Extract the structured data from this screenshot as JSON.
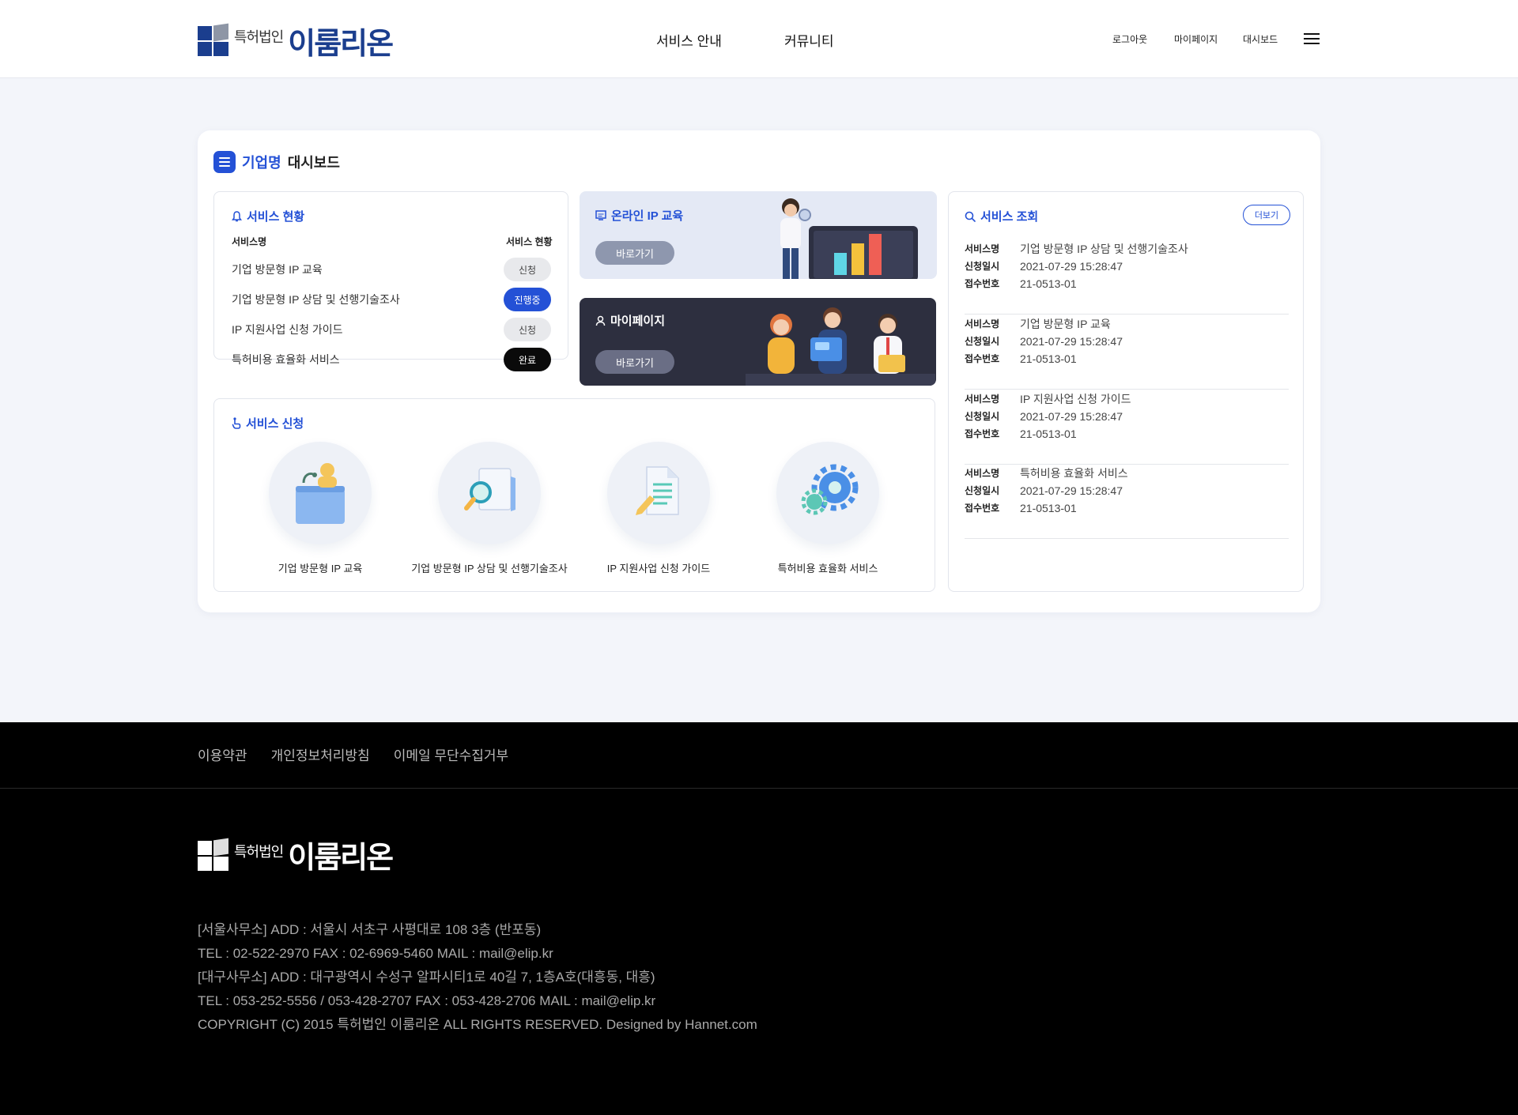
{
  "header": {
    "logo_small": "특허법인",
    "logo_big": "이룸리온",
    "nav": [
      "서비스 안내",
      "커뮤니티"
    ],
    "util": [
      "로그아웃",
      "마이페이지",
      "대시보드"
    ]
  },
  "dashboard": {
    "title_accent": "기업명",
    "title_rest": "대시보드"
  },
  "status_card": {
    "title": "서비스 현황",
    "col_name": "서비스명",
    "col_status": "서비스 현황",
    "rows": [
      {
        "name": "기업 방문형 IP 교육",
        "status": "신청"
      },
      {
        "name": "기업 방문형 IP 상담 및 선행기술조사",
        "status": "진행중"
      },
      {
        "name": "IP 지원사업 신청 가이드",
        "status": "신청"
      },
      {
        "name": "특허비용 효율화 서비스",
        "status": "완료"
      }
    ]
  },
  "online_banner": {
    "title": "온라인 IP 교육",
    "button": "바로가기"
  },
  "mypage_banner": {
    "title": "마이페이지",
    "button": "바로가기"
  },
  "apply_card": {
    "title": "서비스 신청",
    "items": [
      "기업 방문형 IP 교육",
      "기업 방문형 IP 상담 및 선행기술조사",
      "IP 지원사업 신청 가이드",
      "특허비용 효율화 서비스"
    ]
  },
  "query_card": {
    "title": "서비스 조회",
    "more": "더보기",
    "label_name": "서비스명",
    "label_date": "신청일시",
    "label_no": "접수번호",
    "items": [
      {
        "name": "기업 방문형 IP 상담 및 선행기술조사",
        "date": "2021-07-29 15:28:47",
        "no": "21-0513-01"
      },
      {
        "name": "기업 방문형 IP 교육",
        "date": "2021-07-29 15:28:47",
        "no": "21-0513-01"
      },
      {
        "name": "IP 지원사업 신청 가이드",
        "date": "2021-07-29 15:28:47",
        "no": "21-0513-01"
      },
      {
        "name": "특허비용 효율화 서비스",
        "date": "2021-07-29 15:28:47",
        "no": "21-0513-01"
      }
    ]
  },
  "footer": {
    "links": [
      "이용약관",
      "개인정보처리방침",
      "이메일 무단수집거부"
    ],
    "logo_small": "특허법인",
    "logo_big": "이룸리온",
    "address": [
      "[서울사무소] ADD : 서울시 서초구 사평대로 108 3층 (반포동)",
      "TEL : 02-522-2970 FAX : 02-6969-5460 MAIL : mail@elip.kr",
      "[대구사무소] ADD : 대구광역시 수성구 알파시티1로 40길 7, 1층A호(대흥동, 대흥)",
      "TEL : 053-252-5556 / 053-428-2707 FAX : 053-428-2706 MAIL : mail@elip.kr",
      "COPYRIGHT (C) 2015 특허법인 이룸리온 ALL RIGHTS RESERVED. Designed by Hannet.com"
    ]
  },
  "colors": {
    "accent": "#2451d6",
    "brand": "#1b3e8e",
    "dark_banner": "#2d2f3f",
    "light_banner": "#e4e9f5",
    "footer": "#000000"
  }
}
